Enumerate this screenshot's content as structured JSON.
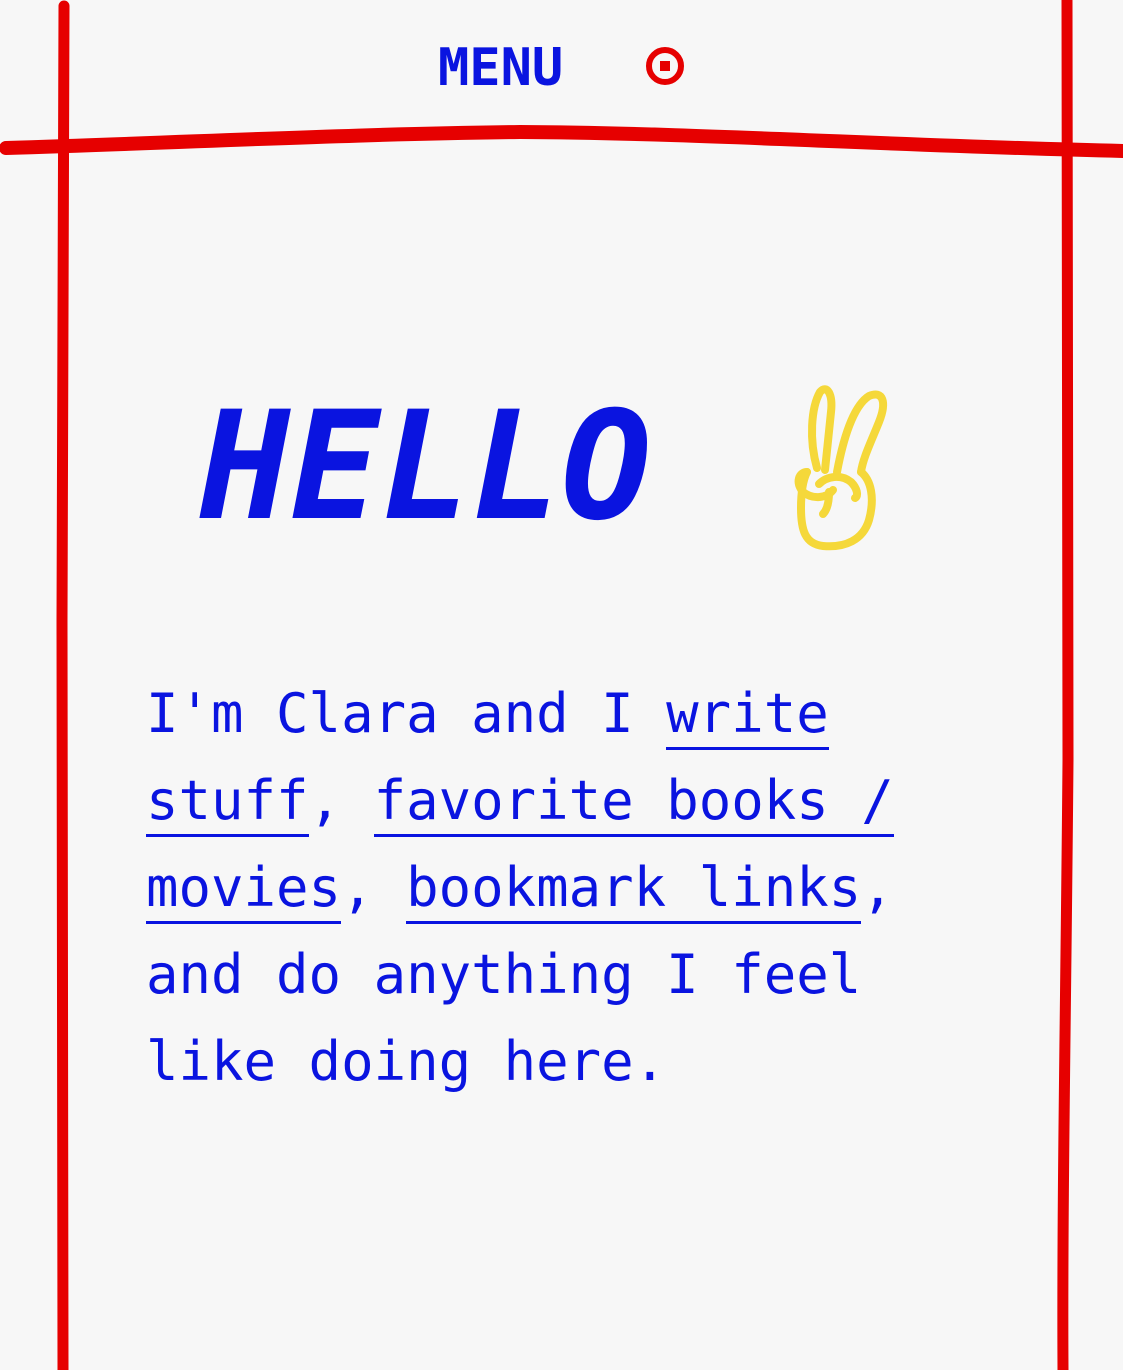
{
  "colors": {
    "background": "#f7f7f7",
    "text": "#0a14e0",
    "frame": "#e60000",
    "accent": "#f5d83a"
  },
  "header": {
    "menu_label": "MENU",
    "menu_icon": "target-icon"
  },
  "hero": {
    "title": "HELLO",
    "icon": "peace-sign-hand-icon"
  },
  "intro": {
    "lead": "I'm Clara and I ",
    "link_write": "write stuff",
    "sep1": ", ",
    "link_books": "favorite books / movies",
    "sep2": ", ",
    "link_bookmarks": "bookmark links",
    "tail": ", and do anything I feel like doing here."
  }
}
